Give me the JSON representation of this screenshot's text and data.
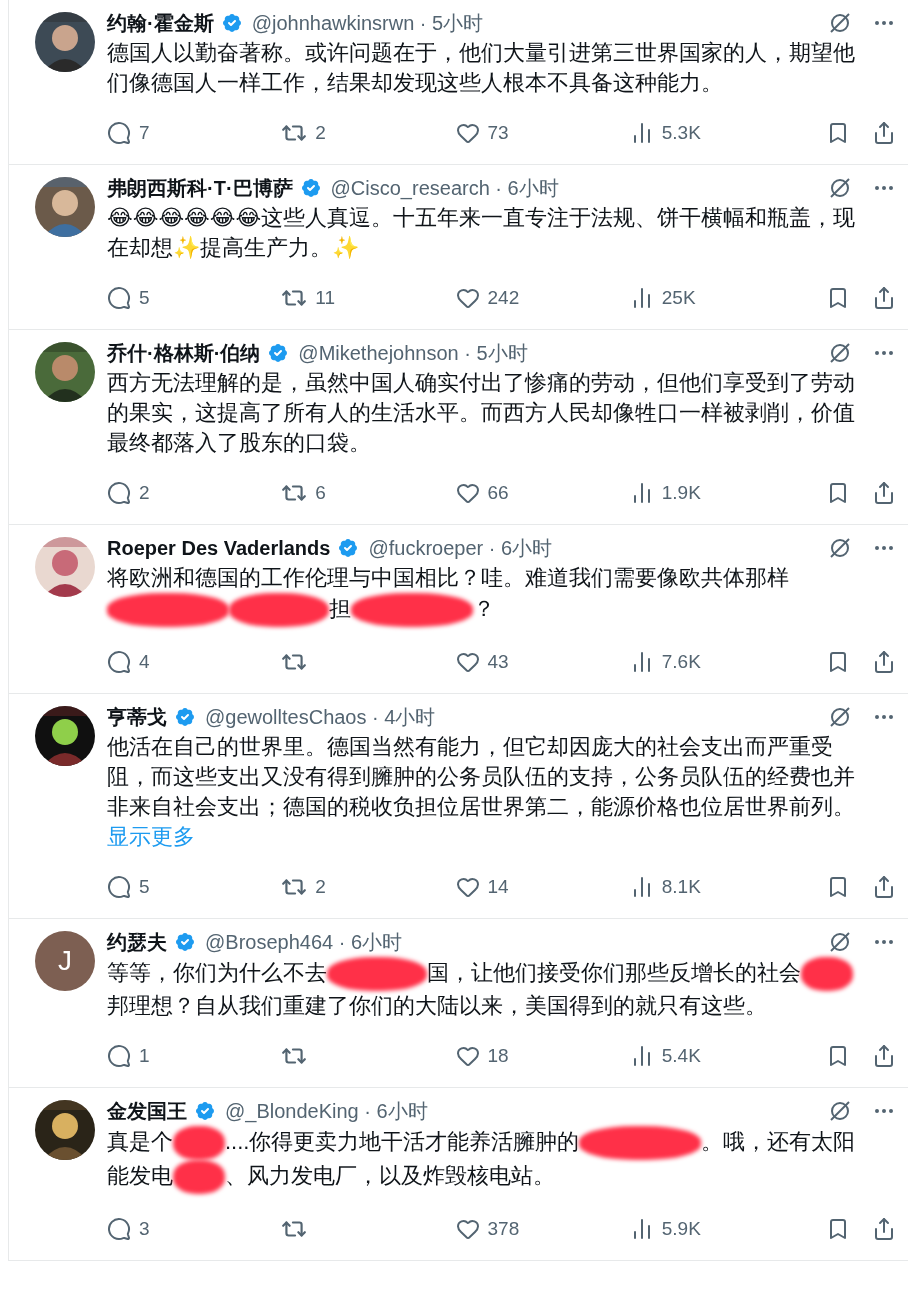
{
  "tweets": [
    {
      "author": "约翰·霍金斯",
      "verified": true,
      "meta": "@johnhawkinsrwn · 5小时",
      "avatar": {
        "kind": "picture"
      },
      "body": [
        {
          "kind": "text",
          "text": "德国人以勤奋著称。或许问题在于，他们大量引进第三世界国家的人，期望他们像德国人一样工作，结果却发现这些人根本不具备这种能力。"
        }
      ],
      "stats": {
        "replies": "7",
        "retweets": "2",
        "likes": "73",
        "views": "5.3K"
      }
    },
    {
      "author": "弗朗西斯科·T·巴博萨",
      "verified": true,
      "meta": "@Cisco_research · 6小时",
      "avatar": {
        "kind": "picture"
      },
      "body": [
        {
          "kind": "text",
          "text": "😂😂😂😂😂😂这些人真逗。十五年来一直专注于法规、饼干横幅和瓶盖，现在却想✨提高生产力。✨"
        }
      ],
      "stats": {
        "replies": "5",
        "retweets": "11",
        "likes": "242",
        "views": "25K"
      }
    },
    {
      "author": "乔什·格林斯·伯纳",
      "verified": true,
      "meta": "@Mikethejohnson · 5小时",
      "avatar": {
        "kind": "picture"
      },
      "body": [
        {
          "kind": "text",
          "text": "西方无法理解的是，虽然中国人确实付出了惨痛的劳动，但他们享受到了劳动的果实，这提高了所有人的生活水平。而西方人民却像牲口一样被剥削，价值最终都落入了股东的口袋。"
        }
      ],
      "stats": {
        "replies": "2",
        "retweets": "6",
        "likes": "66",
        "views": "1.9K"
      }
    },
    {
      "author": "Roeper Des Vaderlands",
      "verified": true,
      "meta": "@fuckroeper · 6小时",
      "avatar": {
        "kind": "picture"
      },
      "body": [
        {
          "kind": "text",
          "text": "将欧洲和德国的工作伦理与中国相比？哇。难道我们需要像欧共体那样"
        },
        {
          "kind": "longredaction"
        },
        {
          "kind": "redaction"
        },
        {
          "kind": "text",
          "text": "担"
        },
        {
          "kind": "longredaction"
        },
        {
          "kind": "text",
          "text": "？"
        }
      ],
      "stats": {
        "replies": "4",
        "likes": "43",
        "views": "7.6K"
      }
    },
    {
      "author": "亨蒂戈",
      "verified": true,
      "meta": "@gewolltesChaos · 4小时",
      "avatar": {
        "kind": "picture"
      },
      "body": [
        {
          "kind": "text",
          "text": "他活在自己的世界里。德国当然有能力，但它却因庞大的社会支出而严重受阻，而这些支出又没有得到臃肿的公务员队伍的支持，公务员队伍的经费也并非来自社会支出；德国的税收负担位居世界第二，能源价格也位居世界前列。"
        }
      ],
      "show_more": "显示更多",
      "stats": {
        "replies": "5",
        "retweets": "2",
        "likes": "14",
        "views": "8.1K"
      }
    },
    {
      "author": "约瑟夫",
      "verified": true,
      "meta": "@Broseph464 · 6小时",
      "avatar": {
        "kind": "letter",
        "letter": "J"
      },
      "body": [
        {
          "kind": "text",
          "text": "等等，你们为什么不去"
        },
        {
          "kind": "redaction"
        },
        {
          "kind": "text",
          "text": "国，让他们接受你们那些反增长的社会"
        },
        {
          "kind": "shortredaction"
        },
        {
          "kind": "text",
          "text": "邦理想？自从我们重建了你们的大陆以来，美国得到的就只有这些。"
        }
      ],
      "stats": {
        "replies": "1",
        "likes": "18",
        "views": "5.4K"
      }
    },
    {
      "author": "金发国王",
      "verified": true,
      "meta": "@_BlondeKing · 6小时",
      "avatar": {
        "kind": "picture"
      },
      "body": [
        {
          "kind": "text",
          "text": "真是个"
        },
        {
          "kind": "shortredaction"
        },
        {
          "kind": "text",
          "text": "....你得更卖力地干活才能养活臃肿的"
        },
        {
          "kind": "longredaction"
        },
        {
          "kind": "text",
          "text": "。哦，还有太阳能发电"
        },
        {
          "kind": "shortredaction"
        },
        {
          "kind": "text",
          "text": "、风力发电厂，以及炸毁核电站。"
        }
      ],
      "stats": {
        "replies": "3",
        "likes": "378",
        "views": "5.9K"
      }
    }
  ]
}
